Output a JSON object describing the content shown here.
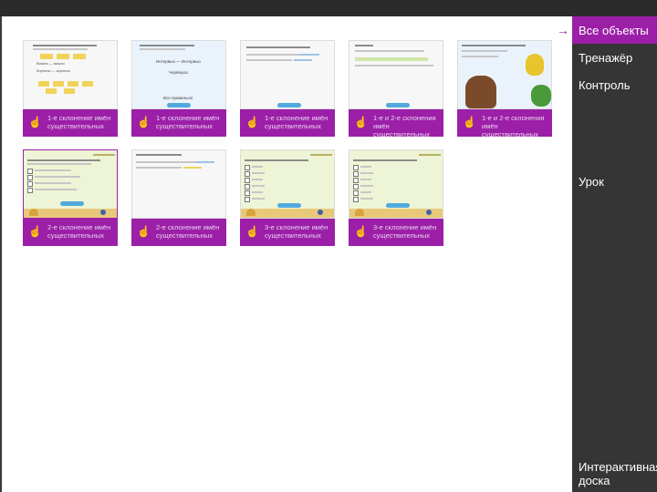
{
  "sidebar": {
    "items": [
      {
        "label": "Все объекты",
        "active": true
      },
      {
        "label": "Тренажёр"
      },
      {
        "label": "Контроль"
      },
      {
        "label": "Урок"
      },
      {
        "label": "Интерактивная доска"
      }
    ]
  },
  "arrow_icon": "arrow-right-icon",
  "cards": [
    {
      "caption": "1-е склонение имён существительных",
      "icon": "hand-icon",
      "thumb_text": [
        "Вишня — вишни",
        "Кирпичи — кирпича"
      ]
    },
    {
      "caption": "1-е склонение имён существительных",
      "icon": "hand-icon",
      "thumb_text": [
        "Интервью — Интервью",
        "Черёмуха",
        "Все правильно!"
      ]
    },
    {
      "caption": "1-е склонение имён существительных",
      "icon": "hand-icon",
      "thumb_text": []
    },
    {
      "caption": "1-е и 2-е склонения имён существительных",
      "icon": "hand-icon",
      "thumb_text": []
    },
    {
      "caption": "1-е и 2-е склонения имён существительных",
      "icon": "hand-icon",
      "thumb_text": []
    },
    {
      "caption": "2-е склонение имён существительных",
      "icon": "hand-icon",
      "thumb_text": []
    },
    {
      "caption": "2-е склонение имён существительных",
      "icon": "hand-icon",
      "thumb_text": []
    },
    {
      "caption": "3-е склонение имён существительных",
      "icon": "hand-icon",
      "thumb_text": []
    },
    {
      "caption": "3-е склонение имён существительных",
      "icon": "hand-icon",
      "thumb_text": []
    }
  ],
  "colors": {
    "accent": "#9c1fa8",
    "sidebar": "#353535",
    "topbar": "#2b2b2b"
  }
}
